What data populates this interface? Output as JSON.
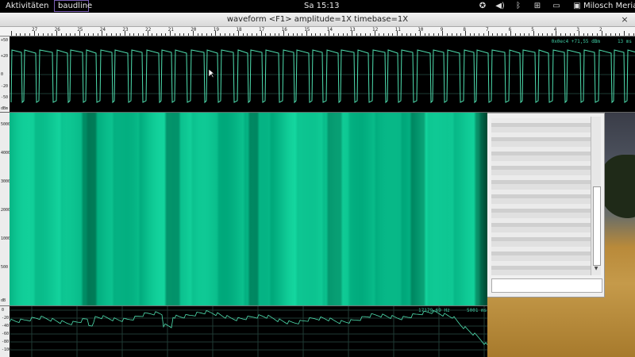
{
  "topbar": {
    "activities": "Aktivitäten",
    "app_name": "baudline",
    "clock": "Sa 15:13",
    "user": "Milosch Meriac",
    "tray_icons": [
      "accessibility-icon",
      "volume-icon",
      "bluetooth-icon",
      "network-icon",
      "power-icon",
      "user-icon"
    ]
  },
  "window": {
    "title": "waveform  <F1> amplitude=1X timebase=1X",
    "close_glyph": "×"
  },
  "ruler": {
    "labels": [
      "27",
      "26",
      "25",
      "24",
      "23",
      "22",
      "21",
      "20",
      "19",
      "18",
      "17",
      "16",
      "15",
      "14",
      "13",
      "12",
      "11",
      "10",
      "9",
      "8",
      "7",
      "6",
      "5",
      "4",
      "3",
      "2"
    ]
  },
  "waveform": {
    "axis_labels": [
      "+50",
      "+20",
      "0",
      "-20",
      "-50",
      "dBm"
    ],
    "readout": "0x0ec4  +71,55 dBm",
    "time": "13 ms",
    "trace_color": "#4fe0b0"
  },
  "spectrogram": {
    "axis_labels": [
      "5000",
      "4000",
      "3000",
      "2000",
      "1000",
      "500",
      "dB"
    ],
    "base_color": "#10c896"
  },
  "spectrum": {
    "axis_labels": [
      "0",
      "-20",
      "-40",
      "-60",
      "-80",
      "-100"
    ],
    "frequency": "17179,69 Hz",
    "time": "5001 ms"
  }
}
